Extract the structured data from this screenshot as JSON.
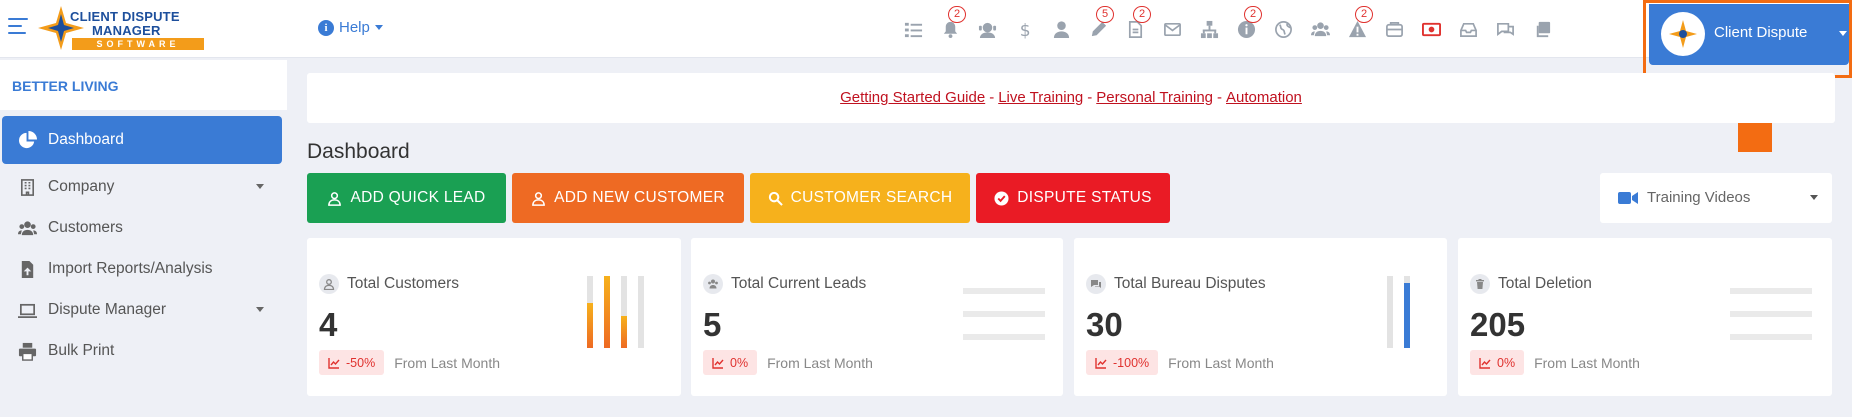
{
  "brand": {
    "logo_line1": "CLIENT DISPUTE",
    "logo_line2": "MANAGER",
    "logo_line3": "SOFTWARE",
    "accent_color": "#3a7bd5",
    "logo_orange": "#f39c1a"
  },
  "header": {
    "help_label": "Help",
    "icons": [
      {
        "name": "tasks-icon",
        "badge": ""
      },
      {
        "name": "bell-icon",
        "badge": "2"
      },
      {
        "name": "support-agent-icon",
        "badge": ""
      },
      {
        "name": "dollar-icon",
        "badge": ""
      },
      {
        "name": "user-tie-icon",
        "badge": ""
      },
      {
        "name": "pen-icon",
        "badge": "5"
      },
      {
        "name": "document-icon",
        "badge": "2"
      },
      {
        "name": "envelope-icon",
        "badge": ""
      },
      {
        "name": "sitemap-icon",
        "badge": ""
      },
      {
        "name": "info-circle-icon",
        "badge": "2"
      },
      {
        "name": "globe-icon",
        "badge": ""
      },
      {
        "name": "users-icon",
        "badge": ""
      },
      {
        "name": "warning-icon",
        "badge": "2"
      },
      {
        "name": "mail-bulk-icon",
        "badge": ""
      },
      {
        "name": "video-record-icon",
        "badge": ""
      },
      {
        "name": "inbox-icon",
        "badge": ""
      },
      {
        "name": "chat-icon",
        "badge": ""
      },
      {
        "name": "copy-icon",
        "badge": ""
      }
    ],
    "profile_name": "Client Dispute",
    "highlight_color": "#f36c12"
  },
  "sidebar": {
    "org_name": "BETTER LIVING",
    "items": [
      {
        "label": "Dashboard",
        "icon": "chart-pie-icon",
        "active": true,
        "has_caret": false
      },
      {
        "label": "Company",
        "icon": "building-icon",
        "active": false,
        "has_caret": true
      },
      {
        "label": "Customers",
        "icon": "users-icon",
        "active": false,
        "has_caret": false
      },
      {
        "label": "Import Reports/Analysis",
        "icon": "file-upload-icon",
        "active": false,
        "has_caret": false
      },
      {
        "label": "Dispute Manager",
        "icon": "laptop-icon",
        "active": false,
        "has_caret": true
      },
      {
        "label": "Bulk Print",
        "icon": "printer-icon",
        "active": false,
        "has_caret": false
      }
    ]
  },
  "main": {
    "links": [
      "Getting Started Guide",
      "Live Training",
      "Personal Training",
      "Automation"
    ],
    "link_separator": "-",
    "page_title": "Dashboard",
    "actions": [
      {
        "label": "ADD QUICK LEAD",
        "icon": "user-icon",
        "color": "#1aa053"
      },
      {
        "label": "ADD NEW CUSTOMER",
        "icon": "user-icon",
        "color": "#ee6a23"
      },
      {
        "label": "CUSTOMER SEARCH",
        "icon": "search-icon",
        "color": "#f6b11c"
      },
      {
        "label": "DISPUTE STATUS",
        "icon": "check-circle-icon",
        "color": "#ea1b25"
      }
    ],
    "training_select": "Training Videos",
    "cards": [
      {
        "title": "Total Customers",
        "value": "4",
        "change": "-50%",
        "foot": "From Last Month",
        "icon": "user-icon"
      },
      {
        "title": "Total Current Leads",
        "value": "5",
        "change": "0%",
        "foot": "From Last Month",
        "icon": "users-icon"
      },
      {
        "title": "Total Bureau Disputes",
        "value": "30",
        "change": "-100%",
        "foot": "From Last Month",
        "icon": "comments-icon"
      },
      {
        "title": "Total Deletion",
        "value": "205",
        "change": "0%",
        "foot": "From Last Month",
        "icon": "trash-icon"
      }
    ]
  }
}
